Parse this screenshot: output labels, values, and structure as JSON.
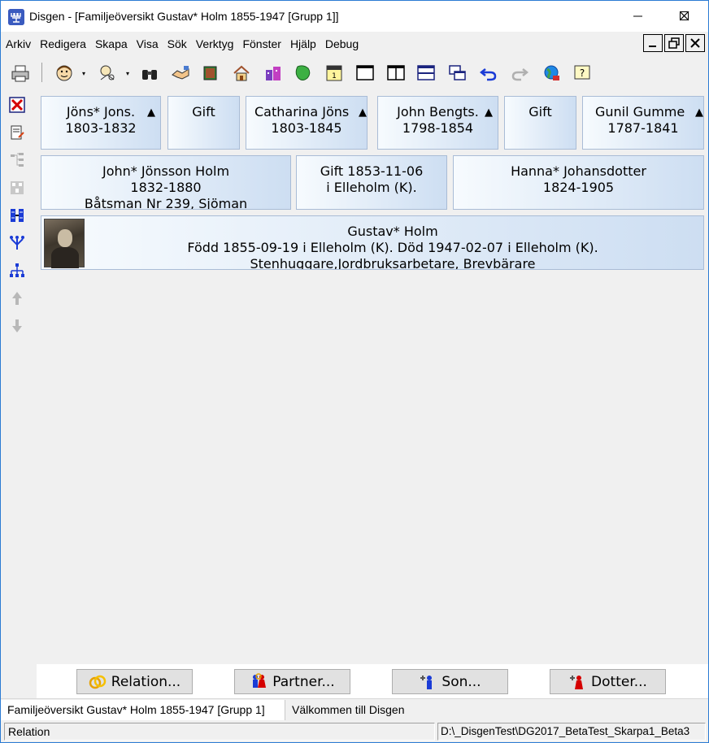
{
  "window": {
    "app_icon_text": "ꟽ",
    "title": "Disgen - [Familjeöversikt Gustav* Holm 1855-1947 [Grupp 1]]"
  },
  "menu": [
    "Arkiv",
    "Redigera",
    "Skapa",
    "Visa",
    "Sök",
    "Verktyg",
    "Fönster",
    "Hjälp",
    "Debug"
  ],
  "grandparents": [
    {
      "name": "Jöns* Jons.",
      "years": "1803-1832",
      "has_up_arrow": true
    },
    {
      "name": "Gift",
      "years": "",
      "has_up_arrow": false
    },
    {
      "name": "Catharina Jöns",
      "years": "1803-1845",
      "has_up_arrow": true
    },
    {
      "name": "John Bengts.",
      "years": "1798-1854",
      "has_up_arrow": true
    },
    {
      "name": "Gift",
      "years": "",
      "has_up_arrow": false
    },
    {
      "name": "Gunil Gumme",
      "years": "1787-1841",
      "has_up_arrow": true
    }
  ],
  "up_arrow": "▲",
  "parents": {
    "father": {
      "name": "John* Jönsson Holm",
      "years": "1832-1880",
      "occupation": "Båtsman Nr 239, Sjöman"
    },
    "marriage": {
      "line1": "Gift 1853-11-06",
      "line2": "i  Elleholm (K)."
    },
    "mother": {
      "name": "Hanna* Johansdotter",
      "years": "1824-1905"
    }
  },
  "main_person": {
    "name": "Gustav* Holm",
    "life": "Född 1855-09-19 i Elleholm (K). Död 1947-02-07 i Elleholm (K).",
    "occupation": "Stenhuggare,Jordbruksarbetare, Brevbärare"
  },
  "buttons": {
    "relation": "Relation...",
    "partner": "Partner...",
    "son": "Son...",
    "dotter": "Dotter..."
  },
  "tabs": [
    {
      "label": "Familjeöversikt Gustav* Holm 1855-1947 [Grupp 1]",
      "active": true
    },
    {
      "label": "Välkommen till Disgen",
      "active": false
    }
  ],
  "status": {
    "left": "Relation",
    "right": "D:\\_DisgenTest\\DG2017_BetaTest_Skarpa1_Beta3"
  },
  "colors": {
    "box_gradient_start": "#f7fbfe",
    "box_gradient_end": "#cddef2",
    "box_border": "#a9bcd6",
    "window_border": "#2b7bd3"
  }
}
